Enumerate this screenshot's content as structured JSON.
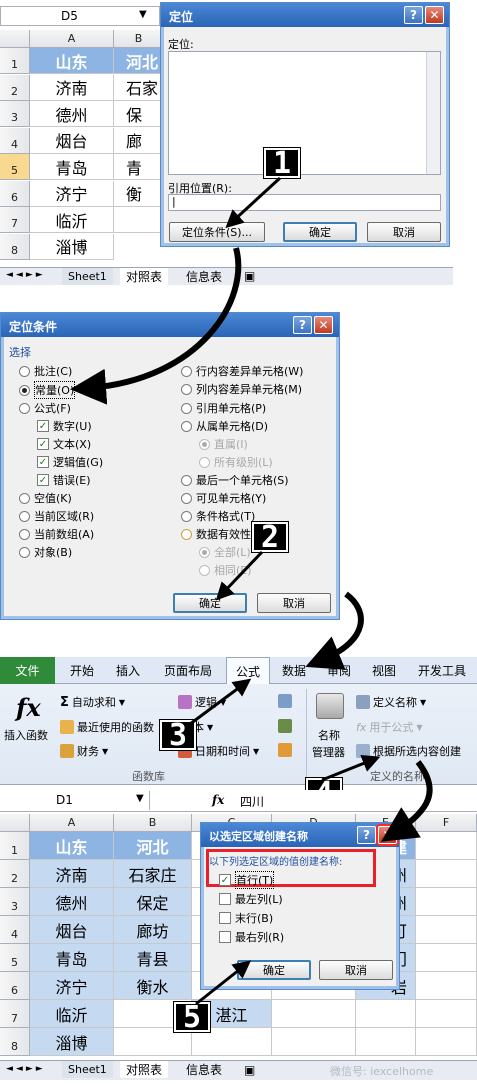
{
  "top_sheet": {
    "name_box": "D5",
    "col_headers": [
      "A",
      "B"
    ],
    "row_headers": [
      "1",
      "2",
      "3",
      "4",
      "5",
      "6",
      "7",
      "8"
    ],
    "col_a": [
      "山东",
      "济南",
      "德州",
      "烟台",
      "青岛",
      "济宁",
      "临沂",
      "淄博"
    ],
    "col_b": [
      "河北",
      "石家",
      "保",
      "廊",
      "青",
      "衡",
      ""
    ],
    "tabs": [
      "Sheet1",
      "对照表",
      "信息表"
    ]
  },
  "goto_dialog": {
    "title": "定位",
    "list_label": "定位:",
    "ref_label": "引用位置(R):",
    "ref_value": "|",
    "special_button": "定位条件(S)...",
    "ok": "确定",
    "cancel": "取消"
  },
  "special_dialog": {
    "title": "定位条件",
    "group_label": "选择",
    "left_options": [
      {
        "label": "批注(C)",
        "state": "off"
      },
      {
        "label": "常量(O)",
        "state": "on"
      },
      {
        "label": "公式(F)",
        "state": "off"
      }
    ],
    "sub_checks": [
      "数字(U)",
      "文本(X)",
      "逻辑值(G)",
      "错误(E)"
    ],
    "left_options2": [
      "空值(K)",
      "当前区域(R)",
      "当前数组(A)",
      "对象(B)"
    ],
    "right_options": [
      "行内容差异单元格(W)",
      "列内容差异单元格(M)",
      "引用单元格(P)",
      "从属单元格(D)"
    ],
    "right_sub": [
      "直属(I)",
      "所有级别(L)"
    ],
    "right_options2": [
      "最后一个单元格(S)",
      "可见单元格(Y)",
      "条件格式(T)",
      "数据有效性"
    ],
    "right_sub2": [
      "全部(L)",
      "相同(E)"
    ],
    "ok": "确定",
    "cancel": "取消"
  },
  "ribbon": {
    "tabs": [
      "文件",
      "开始",
      "插入",
      "页面布局",
      "公式",
      "数据",
      "审阅",
      "视图",
      "开发工具"
    ],
    "insert_function": "插入函数",
    "autosum": "自动求和",
    "recent": "最近使用的函数",
    "finance": "财务",
    "logic": "逻辑",
    "text": "文本",
    "datetime": "日期和时间",
    "group_funclib": "函数库",
    "name_manager_1": "名称",
    "name_manager_2": "管理器",
    "define_name": "定义名称",
    "use_in_formula": "用于公式",
    "create_from_selection": "根据所选内容创建",
    "group_defined": "定义的名称"
  },
  "bottom_sheet": {
    "name_box": "D1",
    "fx": "fx",
    "formula": "四川",
    "col_headers": [
      "A",
      "B",
      "C",
      "D",
      "E",
      "F"
    ],
    "row_headers": [
      "1",
      "2",
      "3",
      "4",
      "5",
      "6",
      "7",
      "8"
    ],
    "col_a": [
      "山东",
      "济南",
      "德州",
      "烟台",
      "青岛",
      "济宁",
      "临沂",
      "淄博"
    ],
    "col_b": [
      "河北",
      "石家庄",
      "保定",
      "廊坊",
      "青县",
      "衡水",
      "",
      ""
    ],
    "col_c7": "湛江",
    "col_e": [
      "建",
      "州",
      "州",
      "可",
      "门",
      "岩"
    ],
    "tabs": [
      "Sheet1",
      "对照表",
      "信息表"
    ],
    "watermark": "微信号: iexcelhome"
  },
  "create_dialog": {
    "title": "以选定区域创建名称",
    "group_label": "以下列选定区域的值创建名称:",
    "options": [
      {
        "label": "首行(T)",
        "checked": true
      },
      {
        "label": "最左列(L)",
        "checked": false
      },
      {
        "label": "末行(B)",
        "checked": false
      },
      {
        "label": "最右列(R)",
        "checked": false
      }
    ],
    "ok": "确定",
    "cancel": "取消"
  },
  "steps": [
    "1",
    "2",
    "3",
    "4",
    "5"
  ]
}
